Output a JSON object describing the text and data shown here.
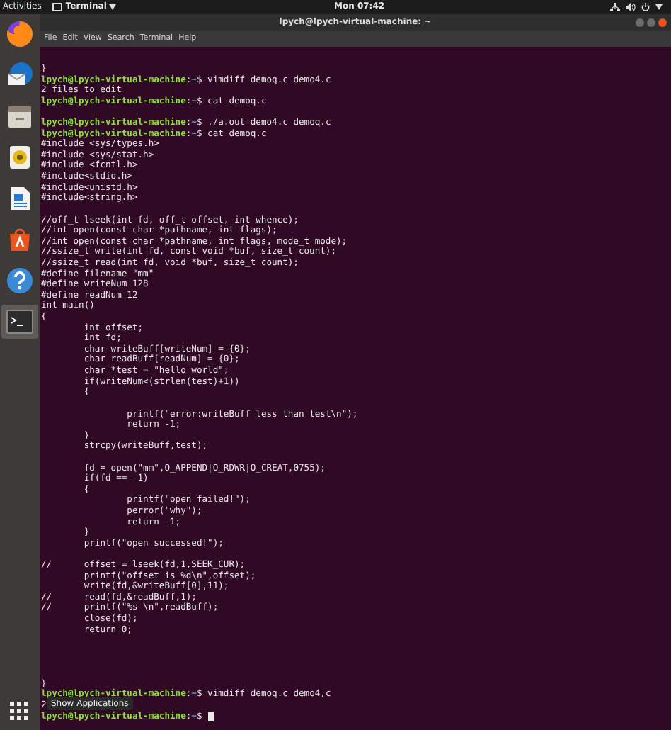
{
  "top_bar": {
    "activities": "Activities",
    "app_menu": "Terminal",
    "clock": "Mon 07:42"
  },
  "dock": {
    "items": [
      {
        "kind": "browser",
        "selected": false
      },
      {
        "kind": "mail",
        "selected": false
      },
      {
        "kind": "files",
        "selected": false
      },
      {
        "kind": "music",
        "selected": false
      },
      {
        "kind": "document",
        "selected": false
      },
      {
        "kind": "store",
        "selected": false
      },
      {
        "kind": "help",
        "selected": false
      },
      {
        "kind": "terminal",
        "selected": true
      }
    ],
    "tooltip": "Show Applications"
  },
  "window": {
    "title": "lpych@lpych-virtual-machine: ~",
    "menu": [
      "File",
      "Edit",
      "View",
      "Search",
      "Terminal",
      "Help"
    ]
  },
  "terminal": {
    "lines": [
      {
        "kind": "text",
        "text": "}"
      },
      {
        "kind": "prompt",
        "user": "lpych@lpych-virtual-machine",
        "sep": ":",
        "path": "~",
        "sigil": "$",
        "command": "vimdiff demoq.c demo4.c",
        "cursor": false
      },
      {
        "kind": "text",
        "text": "2 files to edit"
      },
      {
        "kind": "prompt",
        "user": "lpych@lpych-virtual-machine",
        "sep": ":",
        "path": "~",
        "sigil": "$",
        "command": "cat demoq.c",
        "cursor": false
      },
      {
        "kind": "blank"
      },
      {
        "kind": "prompt",
        "user": "lpych@lpych-virtual-machine",
        "sep": ":",
        "path": "~",
        "sigil": "$",
        "command": "./a.out demo4.c demoq.c",
        "cursor": false
      },
      {
        "kind": "prompt",
        "user": "lpych@lpych-virtual-machine",
        "sep": ":",
        "path": "~",
        "sigil": "$",
        "command": "cat demoq.c",
        "cursor": false
      },
      {
        "kind": "text",
        "text": "#include <sys/types.h>"
      },
      {
        "kind": "text",
        "text": "#include <sys/stat.h>"
      },
      {
        "kind": "text",
        "text": "#include <fcntl.h>"
      },
      {
        "kind": "text",
        "text": "#include<stdio.h>"
      },
      {
        "kind": "text",
        "text": "#include<unistd.h>"
      },
      {
        "kind": "text",
        "text": "#include<string.h>"
      },
      {
        "kind": "blank"
      },
      {
        "kind": "text",
        "text": "//off_t lseek(int fd, off_t offset, int whence);"
      },
      {
        "kind": "text",
        "text": "//int open(const char *pathname, int flags);"
      },
      {
        "kind": "text",
        "text": "//int open(const char *pathname, int flags, mode_t mode);"
      },
      {
        "kind": "text",
        "text": "//ssize_t write(int fd, const void *buf, size_t count);"
      },
      {
        "kind": "text",
        "text": "//ssize_t read(int fd, void *buf, size_t count);"
      },
      {
        "kind": "text",
        "text": "#define filename \"mm\""
      },
      {
        "kind": "text",
        "text": "#define writeNum 128"
      },
      {
        "kind": "text",
        "text": "#define readNum 12"
      },
      {
        "kind": "text",
        "text": "int main()"
      },
      {
        "kind": "text",
        "text": "{"
      },
      {
        "kind": "text",
        "text": "\tint offset;"
      },
      {
        "kind": "text",
        "text": "\tint fd;"
      },
      {
        "kind": "text",
        "text": "\tchar writeBuff[writeNum] = {0};"
      },
      {
        "kind": "text",
        "text": "\tchar readBuff[readNum] = {0};"
      },
      {
        "kind": "text",
        "text": "\tchar *test = \"hello world\";"
      },
      {
        "kind": "text",
        "text": "\tif(writeNum<(strlen(test)+1))"
      },
      {
        "kind": "text",
        "text": "\t{"
      },
      {
        "kind": "blank"
      },
      {
        "kind": "text",
        "text": "\t\tprintf(\"error:writeBuff less than test\\n\");"
      },
      {
        "kind": "text",
        "text": "\t\treturn -1;"
      },
      {
        "kind": "text",
        "text": "\t}"
      },
      {
        "kind": "text",
        "text": "\tstrcpy(writeBuff,test);"
      },
      {
        "kind": "blank"
      },
      {
        "kind": "text",
        "text": "\tfd = open(\"mm\",O_APPEND|O_RDWR|O_CREAT,0755);"
      },
      {
        "kind": "text",
        "text": "\tif(fd == -1)"
      },
      {
        "kind": "text",
        "text": "\t{"
      },
      {
        "kind": "text",
        "text": "\t\tprintf(\"open failed!\");"
      },
      {
        "kind": "text",
        "text": "\t\tperror(\"why\");"
      },
      {
        "kind": "text",
        "text": "\t\treturn -1;"
      },
      {
        "kind": "text",
        "text": "\t}"
      },
      {
        "kind": "text",
        "text": "\tprintf(\"open successed!\");"
      },
      {
        "kind": "blank"
      },
      {
        "kind": "text",
        "text": "//\toffset = lseek(fd,1,SEEK_CUR);"
      },
      {
        "kind": "text",
        "text": "\tprintf(\"offset is %d\\n\",offset);"
      },
      {
        "kind": "text",
        "text": "\twrite(fd,&writeBuff[0],11);"
      },
      {
        "kind": "text",
        "text": "//\tread(fd,&readBuff,1);"
      },
      {
        "kind": "text",
        "text": "//\tprintf(\"%s \\n\",readBuff);"
      },
      {
        "kind": "text",
        "text": "\tclose(fd);"
      },
      {
        "kind": "text",
        "text": "\treturn 0;"
      },
      {
        "kind": "blank"
      },
      {
        "kind": "blank"
      },
      {
        "kind": "blank"
      },
      {
        "kind": "blank"
      },
      {
        "kind": "text",
        "text": "}"
      },
      {
        "kind": "prompt",
        "user": "lpych@lpych-virtual-machine",
        "sep": ":",
        "path": "~",
        "sigil": "$",
        "command": "vimdiff demoq.c demo4,c",
        "cursor": false
      },
      {
        "kind": "text",
        "text": "2"
      },
      {
        "kind": "prompt",
        "user": "lpych@lpych-virtual-machine",
        "sep": ":",
        "path": "~",
        "sigil": "$",
        "cursor": true
      }
    ]
  }
}
